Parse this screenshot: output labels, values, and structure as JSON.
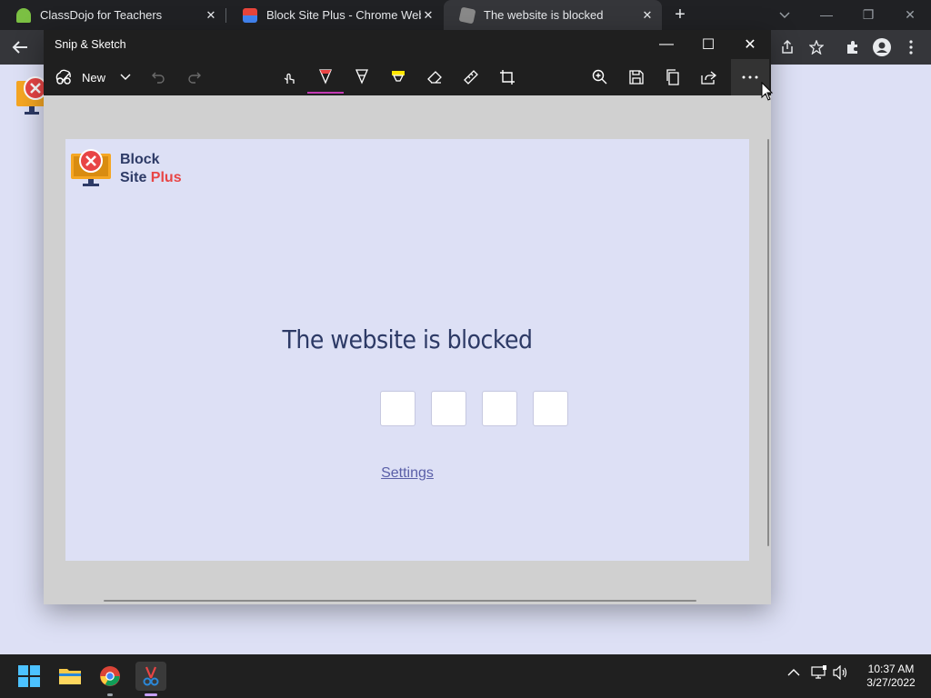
{
  "browser": {
    "tabs": [
      {
        "title": "ClassDojo for Teachers",
        "active": false,
        "favicon_color": "#7bc043"
      },
      {
        "title": "Block Site Plus - Chrome Web Sto",
        "active": false,
        "favicon_color": "#e8453c"
      },
      {
        "title": "The website is blocked",
        "active": true,
        "favicon_color": "#8a8a8a"
      }
    ],
    "tab_close_glyph": "✕",
    "new_tab_glyph": "+",
    "window_controls": {
      "minimize": "—",
      "restore": "❐",
      "close": "✕"
    },
    "toolbar_icons": [
      "back-arrow-icon",
      "share-icon",
      "star-icon",
      "extensions-puzzle-icon",
      "profile-icon",
      "kebab-menu-icon"
    ]
  },
  "snip": {
    "title": "Snip & Sketch",
    "new_label": "New",
    "controls": {
      "minimize": "—",
      "maximize": "☐",
      "close": "✕"
    },
    "tools": [
      "touch-writing-icon",
      "ballpoint-pen-icon",
      "pencil-icon",
      "highlighter-icon",
      "eraser-icon",
      "ruler-icon",
      "crop-icon",
      "zoom-icon",
      "save-icon",
      "copy-icon",
      "share-icon",
      "more-icon"
    ],
    "accent_color": "#c239b3"
  },
  "blocked_page": {
    "logo_line1": "Block",
    "logo_line2_a": "Site",
    "logo_line2_b": "Plus",
    "heading": "The website is blocked",
    "pin_boxes": 4,
    "settings_link": "Settings",
    "colors": {
      "navy": "#2d3a66",
      "red": "#e84545",
      "bg": "#dde0f5",
      "monitor": "#f5a623"
    }
  },
  "taskbar": {
    "apps": [
      "windows-start-icon",
      "file-explorer-icon",
      "chrome-icon",
      "snip-sketch-icon"
    ],
    "tray_icons": [
      "chevron-up-icon",
      "network-icon",
      "volume-icon"
    ],
    "time": "10:37 AM",
    "date": "3/27/2022"
  }
}
